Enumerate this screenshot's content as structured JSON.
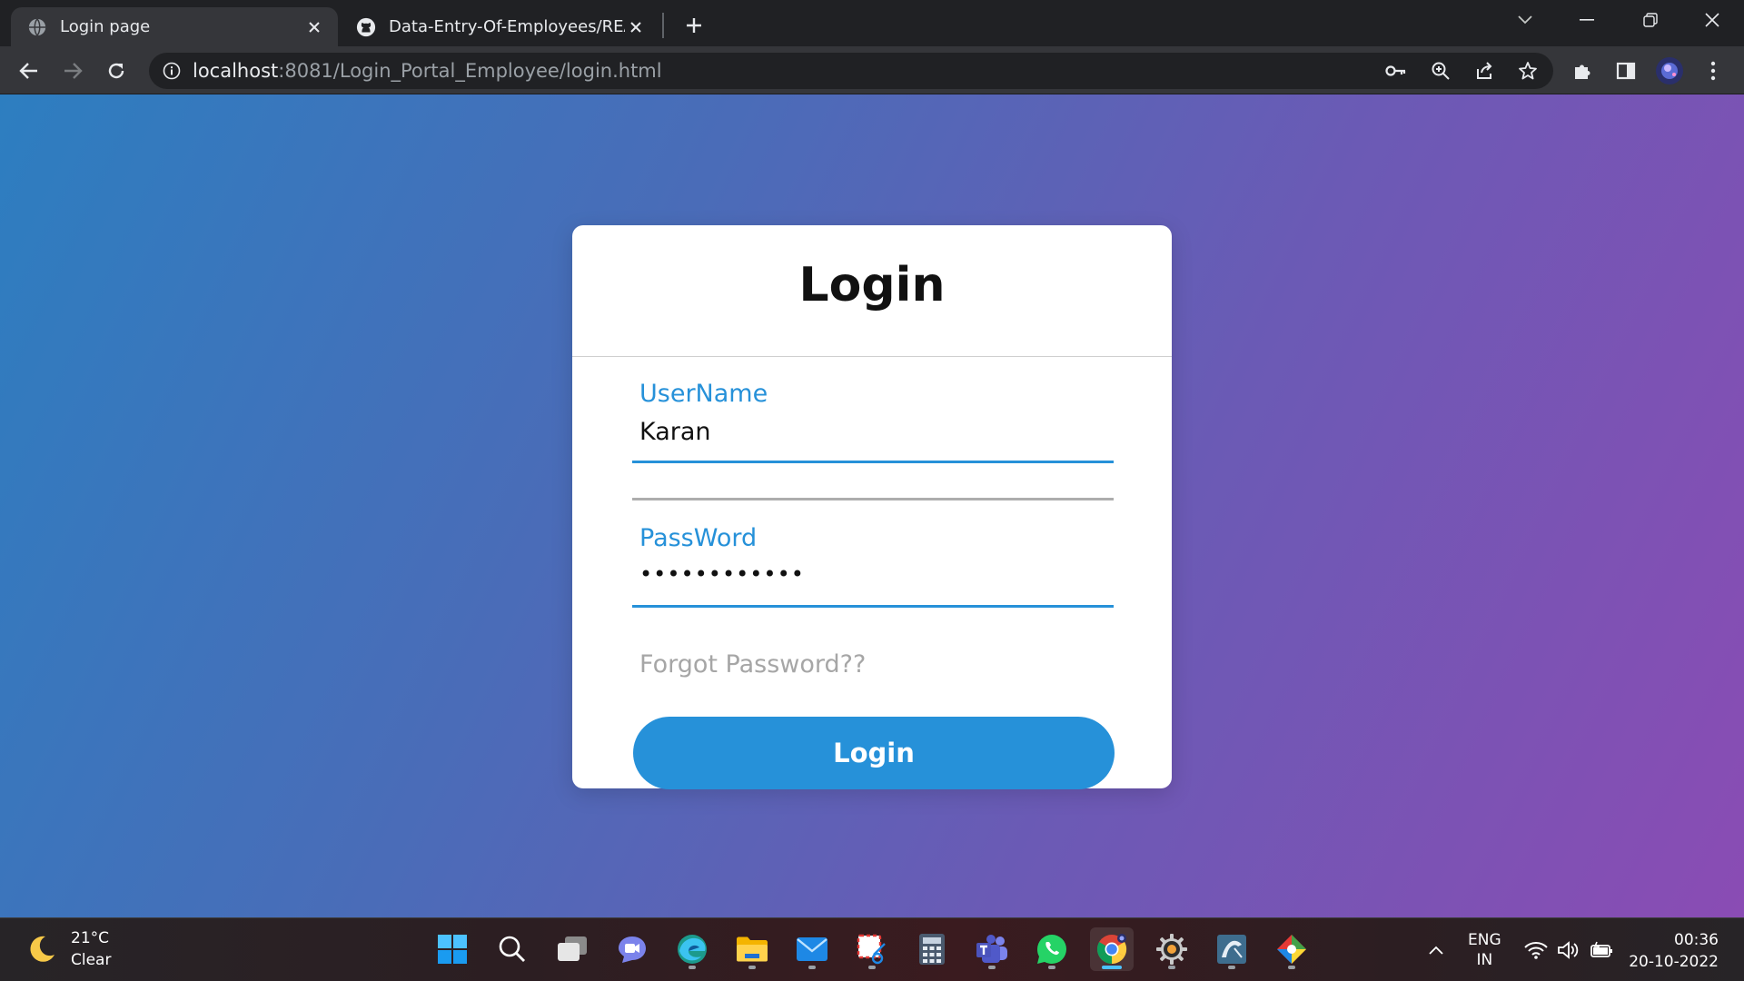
{
  "browser": {
    "tabs": [
      {
        "title": "Login page",
        "icon": "globe-icon",
        "active": true
      },
      {
        "title": "Data-Entry-Of-Employees/READM",
        "icon": "github-icon",
        "active": false
      }
    ],
    "address": {
      "host": "localhost",
      "rest": ":8081/Login_Portal_Employee/login.html"
    }
  },
  "login": {
    "title": "Login",
    "username_label": "UserName",
    "username_value": "Karan",
    "password_label": "PassWord",
    "password_mask": "••••••••••••",
    "forgot_link": "Forgot Password??",
    "button_label": "Login"
  },
  "taskbar": {
    "weather": {
      "temp": "21°C",
      "condition": "Clear"
    },
    "language": {
      "line1": "ENG",
      "line2": "IN"
    },
    "time": "00:36",
    "date": "20-10-2022"
  },
  "colors": {
    "accent": "#2691d9",
    "gradient_start": "#2d7ec0",
    "gradient_end": "#8a4cb4"
  }
}
